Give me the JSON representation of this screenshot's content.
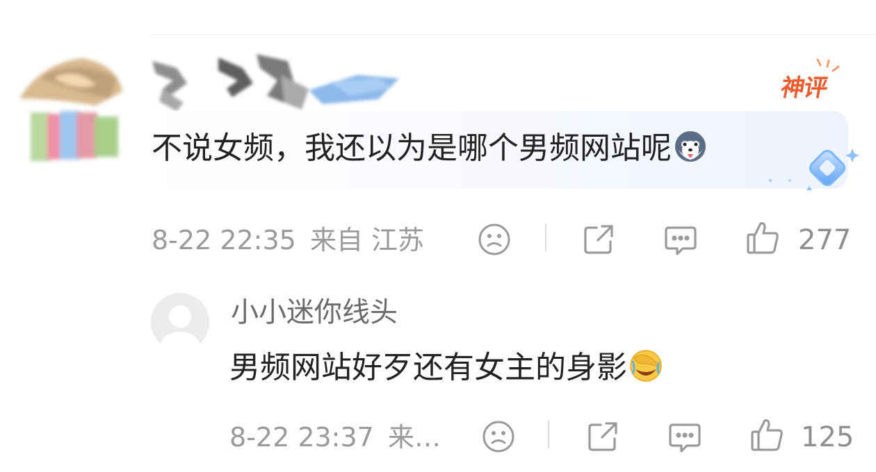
{
  "comment": {
    "text": "不说女频，我还以为是哪个男频网站呢",
    "badge": "神评",
    "timestamp": "8-22 22:35",
    "location": "来自 江苏",
    "like_count": "277",
    "emoji": "husky-face-emoji"
  },
  "reply": {
    "username": "小小迷你线头",
    "text": "男频网站好歹还有女主的身影",
    "timestamp": "8-22 23:37",
    "location": "来…",
    "like_count": "125",
    "emoji": "facepalm-laugh-emoji"
  },
  "colors": {
    "badge": "#ee5a2a",
    "meta_text": "#9a9a9a",
    "main_text": "#222222",
    "username": "#6b6b6b",
    "bubble_accent": "#eef3ff"
  }
}
